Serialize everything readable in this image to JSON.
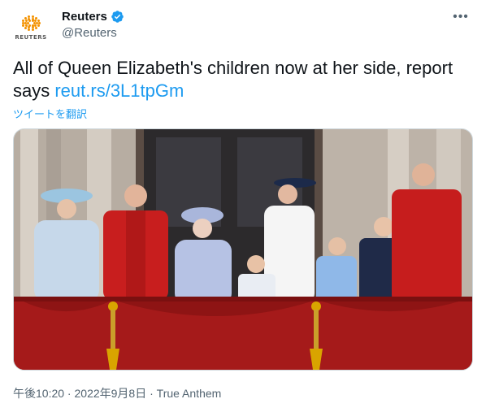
{
  "author": {
    "display_name": "Reuters",
    "handle": "@Reuters",
    "logo_text": "REUTERS",
    "verified_icon": "verified-badge-icon",
    "brand_color": "#f39200"
  },
  "tweet": {
    "text": "All of Queen Elizabeth's children now at her side, report says ",
    "link_text": "reut.rs/3L1tpGm",
    "translate_label": "ツイートを翻訳",
    "more_icon": "more-options-icon"
  },
  "meta": {
    "time": "午後10:20",
    "separator": " · ",
    "date": "2022年9月8日",
    "source": "True Anthem"
  },
  "colors": {
    "link": "#1d9bf0",
    "secondary_text": "#536471"
  }
}
